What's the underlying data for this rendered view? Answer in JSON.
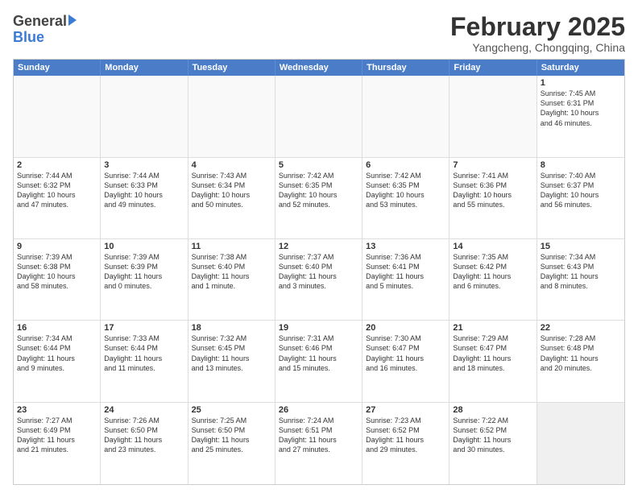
{
  "header": {
    "logo_line1": "General",
    "logo_line2": "Blue",
    "month_year": "February 2025",
    "location": "Yangcheng, Chongqing, China"
  },
  "days_of_week": [
    "Sunday",
    "Monday",
    "Tuesday",
    "Wednesday",
    "Thursday",
    "Friday",
    "Saturday"
  ],
  "weeks": [
    {
      "cells": [
        {
          "day": "",
          "text": ""
        },
        {
          "day": "",
          "text": ""
        },
        {
          "day": "",
          "text": ""
        },
        {
          "day": "",
          "text": ""
        },
        {
          "day": "",
          "text": ""
        },
        {
          "day": "",
          "text": ""
        },
        {
          "day": "1",
          "text": "Sunrise: 7:45 AM\nSunset: 6:31 PM\nDaylight: 10 hours\nand 46 minutes."
        }
      ]
    },
    {
      "cells": [
        {
          "day": "2",
          "text": "Sunrise: 7:44 AM\nSunset: 6:32 PM\nDaylight: 10 hours\nand 47 minutes."
        },
        {
          "day": "3",
          "text": "Sunrise: 7:44 AM\nSunset: 6:33 PM\nDaylight: 10 hours\nand 49 minutes."
        },
        {
          "day": "4",
          "text": "Sunrise: 7:43 AM\nSunset: 6:34 PM\nDaylight: 10 hours\nand 50 minutes."
        },
        {
          "day": "5",
          "text": "Sunrise: 7:42 AM\nSunset: 6:35 PM\nDaylight: 10 hours\nand 52 minutes."
        },
        {
          "day": "6",
          "text": "Sunrise: 7:42 AM\nSunset: 6:35 PM\nDaylight: 10 hours\nand 53 minutes."
        },
        {
          "day": "7",
          "text": "Sunrise: 7:41 AM\nSunset: 6:36 PM\nDaylight: 10 hours\nand 55 minutes."
        },
        {
          "day": "8",
          "text": "Sunrise: 7:40 AM\nSunset: 6:37 PM\nDaylight: 10 hours\nand 56 minutes."
        }
      ]
    },
    {
      "cells": [
        {
          "day": "9",
          "text": "Sunrise: 7:39 AM\nSunset: 6:38 PM\nDaylight: 10 hours\nand 58 minutes."
        },
        {
          "day": "10",
          "text": "Sunrise: 7:39 AM\nSunset: 6:39 PM\nDaylight: 11 hours\nand 0 minutes."
        },
        {
          "day": "11",
          "text": "Sunrise: 7:38 AM\nSunset: 6:40 PM\nDaylight: 11 hours\nand 1 minute."
        },
        {
          "day": "12",
          "text": "Sunrise: 7:37 AM\nSunset: 6:40 PM\nDaylight: 11 hours\nand 3 minutes."
        },
        {
          "day": "13",
          "text": "Sunrise: 7:36 AM\nSunset: 6:41 PM\nDaylight: 11 hours\nand 5 minutes."
        },
        {
          "day": "14",
          "text": "Sunrise: 7:35 AM\nSunset: 6:42 PM\nDaylight: 11 hours\nand 6 minutes."
        },
        {
          "day": "15",
          "text": "Sunrise: 7:34 AM\nSunset: 6:43 PM\nDaylight: 11 hours\nand 8 minutes."
        }
      ]
    },
    {
      "cells": [
        {
          "day": "16",
          "text": "Sunrise: 7:34 AM\nSunset: 6:44 PM\nDaylight: 11 hours\nand 9 minutes."
        },
        {
          "day": "17",
          "text": "Sunrise: 7:33 AM\nSunset: 6:44 PM\nDaylight: 11 hours\nand 11 minutes."
        },
        {
          "day": "18",
          "text": "Sunrise: 7:32 AM\nSunset: 6:45 PM\nDaylight: 11 hours\nand 13 minutes."
        },
        {
          "day": "19",
          "text": "Sunrise: 7:31 AM\nSunset: 6:46 PM\nDaylight: 11 hours\nand 15 minutes."
        },
        {
          "day": "20",
          "text": "Sunrise: 7:30 AM\nSunset: 6:47 PM\nDaylight: 11 hours\nand 16 minutes."
        },
        {
          "day": "21",
          "text": "Sunrise: 7:29 AM\nSunset: 6:47 PM\nDaylight: 11 hours\nand 18 minutes."
        },
        {
          "day": "22",
          "text": "Sunrise: 7:28 AM\nSunset: 6:48 PM\nDaylight: 11 hours\nand 20 minutes."
        }
      ]
    },
    {
      "cells": [
        {
          "day": "23",
          "text": "Sunrise: 7:27 AM\nSunset: 6:49 PM\nDaylight: 11 hours\nand 21 minutes."
        },
        {
          "day": "24",
          "text": "Sunrise: 7:26 AM\nSunset: 6:50 PM\nDaylight: 11 hours\nand 23 minutes."
        },
        {
          "day": "25",
          "text": "Sunrise: 7:25 AM\nSunset: 6:50 PM\nDaylight: 11 hours\nand 25 minutes."
        },
        {
          "day": "26",
          "text": "Sunrise: 7:24 AM\nSunset: 6:51 PM\nDaylight: 11 hours\nand 27 minutes."
        },
        {
          "day": "27",
          "text": "Sunrise: 7:23 AM\nSunset: 6:52 PM\nDaylight: 11 hours\nand 29 minutes."
        },
        {
          "day": "28",
          "text": "Sunrise: 7:22 AM\nSunset: 6:52 PM\nDaylight: 11 hours\nand 30 minutes."
        },
        {
          "day": "",
          "text": ""
        }
      ]
    }
  ]
}
